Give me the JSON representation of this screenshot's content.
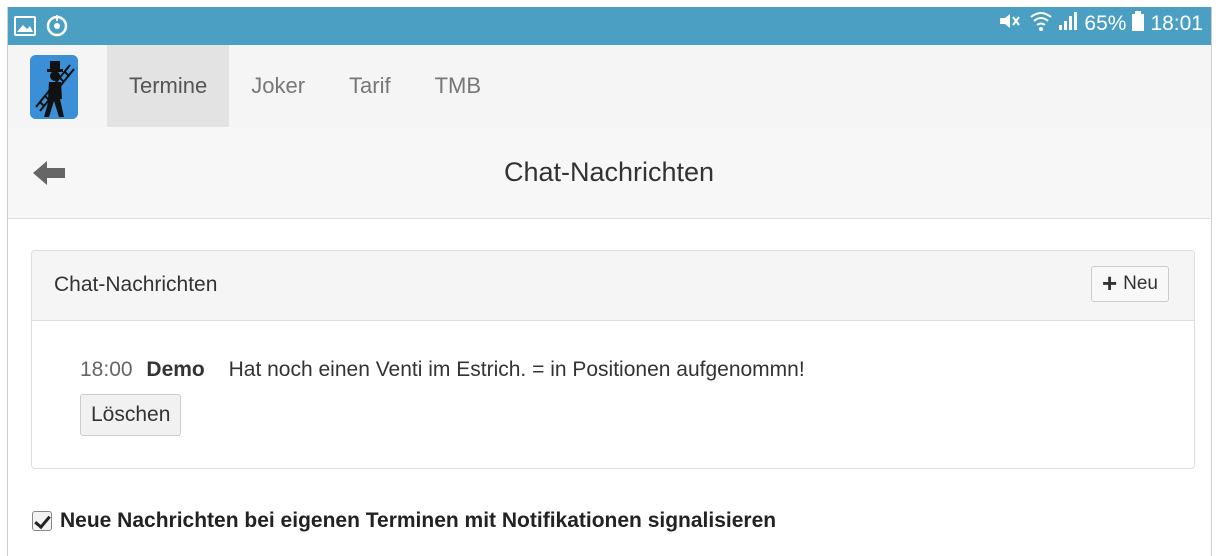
{
  "status_bar": {
    "left_icons": [
      "gallery-icon",
      "sync-icon"
    ],
    "right_icons": [
      "mute-icon",
      "wifi-icon",
      "signal-icon"
    ],
    "battery": "65%",
    "time": "18:01",
    "color": "#4a9fc3"
  },
  "nav": {
    "tabs": [
      {
        "label": "Termine",
        "active": true
      },
      {
        "label": "Joker",
        "active": false
      },
      {
        "label": "Tarif",
        "active": false
      },
      {
        "label": "TMB",
        "active": false
      }
    ]
  },
  "header": {
    "title": "Chat-Nachrichten"
  },
  "panel": {
    "title": "Chat-Nachrichten",
    "new_button": "Neu",
    "messages": [
      {
        "time": "18:00",
        "user": "Demo",
        "text": "Hat noch einen Venti im Estrich. = in Positionen aufgenommn!",
        "delete_label": "Löschen"
      }
    ]
  },
  "settings": {
    "notify_checked": true,
    "notify_label": "Neue Nachrichten bei eigenen Terminen mit Notifikationen signalisieren"
  }
}
